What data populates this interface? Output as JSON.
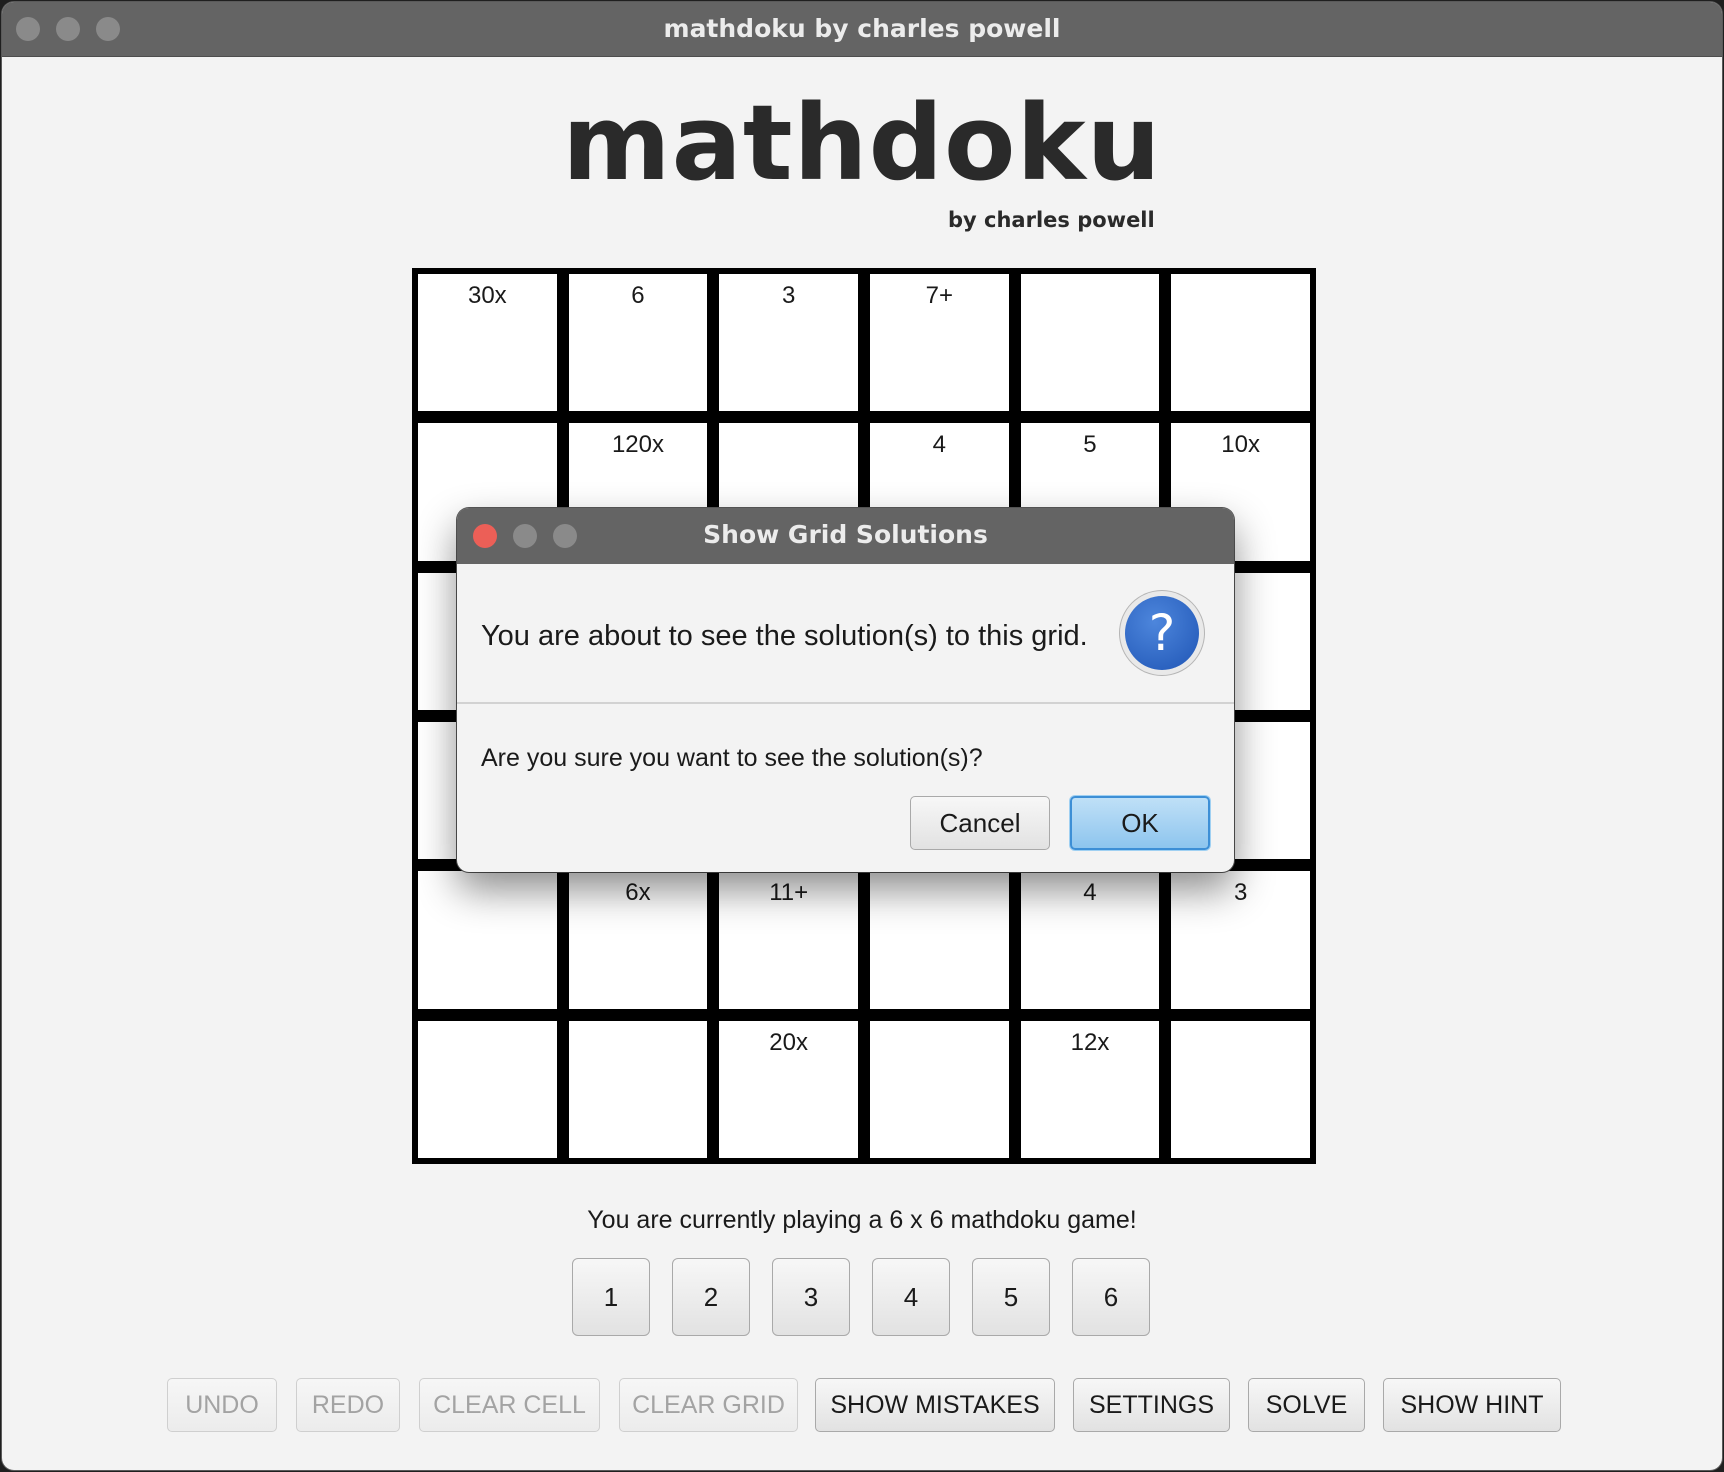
{
  "window": {
    "title": "mathdoku by charles powell"
  },
  "app": {
    "title": "mathdoku",
    "subtitle": "by charles powell"
  },
  "grid": {
    "size": 6,
    "cage_labels": [
      [
        "30x",
        "6",
        "3",
        "7+",
        "",
        ""
      ],
      [
        "",
        "120x",
        "",
        "4",
        "5",
        "10x"
      ],
      [
        "",
        "",
        "",
        "",
        "",
        ""
      ],
      [
        "",
        "",
        "",
        "",
        "",
        ""
      ],
      [
        "",
        "6x",
        "11+",
        "",
        "4",
        "3"
      ],
      [
        "",
        "",
        "20x",
        "",
        "12x",
        ""
      ]
    ]
  },
  "status": {
    "text": "You are currently playing a 6 x 6 mathdoku game!"
  },
  "number_buttons": [
    "1",
    "2",
    "3",
    "4",
    "5",
    "6"
  ],
  "actions": {
    "undo": "UNDO",
    "redo": "REDO",
    "clear_cell": "CLEAR CELL",
    "clear_grid": "CLEAR GRID",
    "show_mistakes": "SHOW MISTAKES",
    "settings": "SETTINGS",
    "solve": "SOLVE",
    "show_hint": "SHOW HINT"
  },
  "dialog": {
    "title": "Show Grid Solutions",
    "header": "You are about to see the solution(s) to this grid.",
    "icon": "question-icon",
    "icon_glyph": "?",
    "content": "Are you sure you want to see the solution(s)?",
    "cancel_label": "Cancel",
    "ok_label": "OK"
  },
  "colors": {
    "titlebar": "#646464",
    "close_button": "#ec5f57",
    "dialog_ok": "#8ec5ee",
    "question_icon": "#2a62c4"
  }
}
